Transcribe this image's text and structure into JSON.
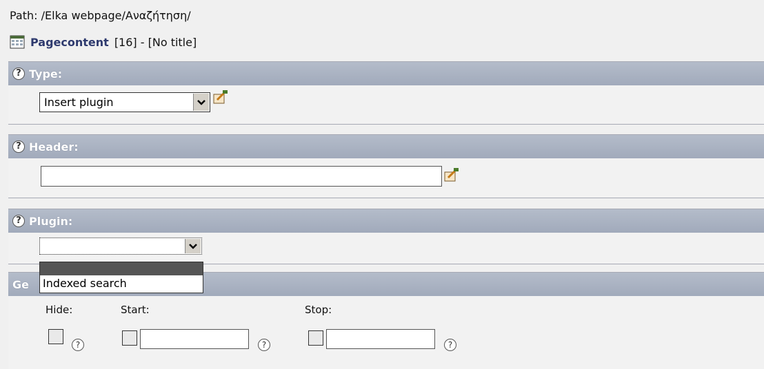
{
  "path": "Path: /Elka webpage/Αναζήτηση/",
  "record": {
    "name": "Pagecontent",
    "suffix": "[16] - [No title]"
  },
  "sections": {
    "type": {
      "title": "Type:",
      "value": "Insert plugin"
    },
    "header": {
      "title": "Header:",
      "value": ""
    },
    "plugin": {
      "title": "Plugin:",
      "value": "",
      "options": [
        "",
        "Indexed search"
      ]
    },
    "general": {
      "title": "Ge"
    }
  },
  "fields": {
    "hide": "Hide:",
    "start": "Start:",
    "stop": "Stop:"
  },
  "icons": {
    "record": "table-icon",
    "wizard": "edit-wizard-icon",
    "help": "help-icon",
    "arrow": "chevron-down-icon"
  }
}
